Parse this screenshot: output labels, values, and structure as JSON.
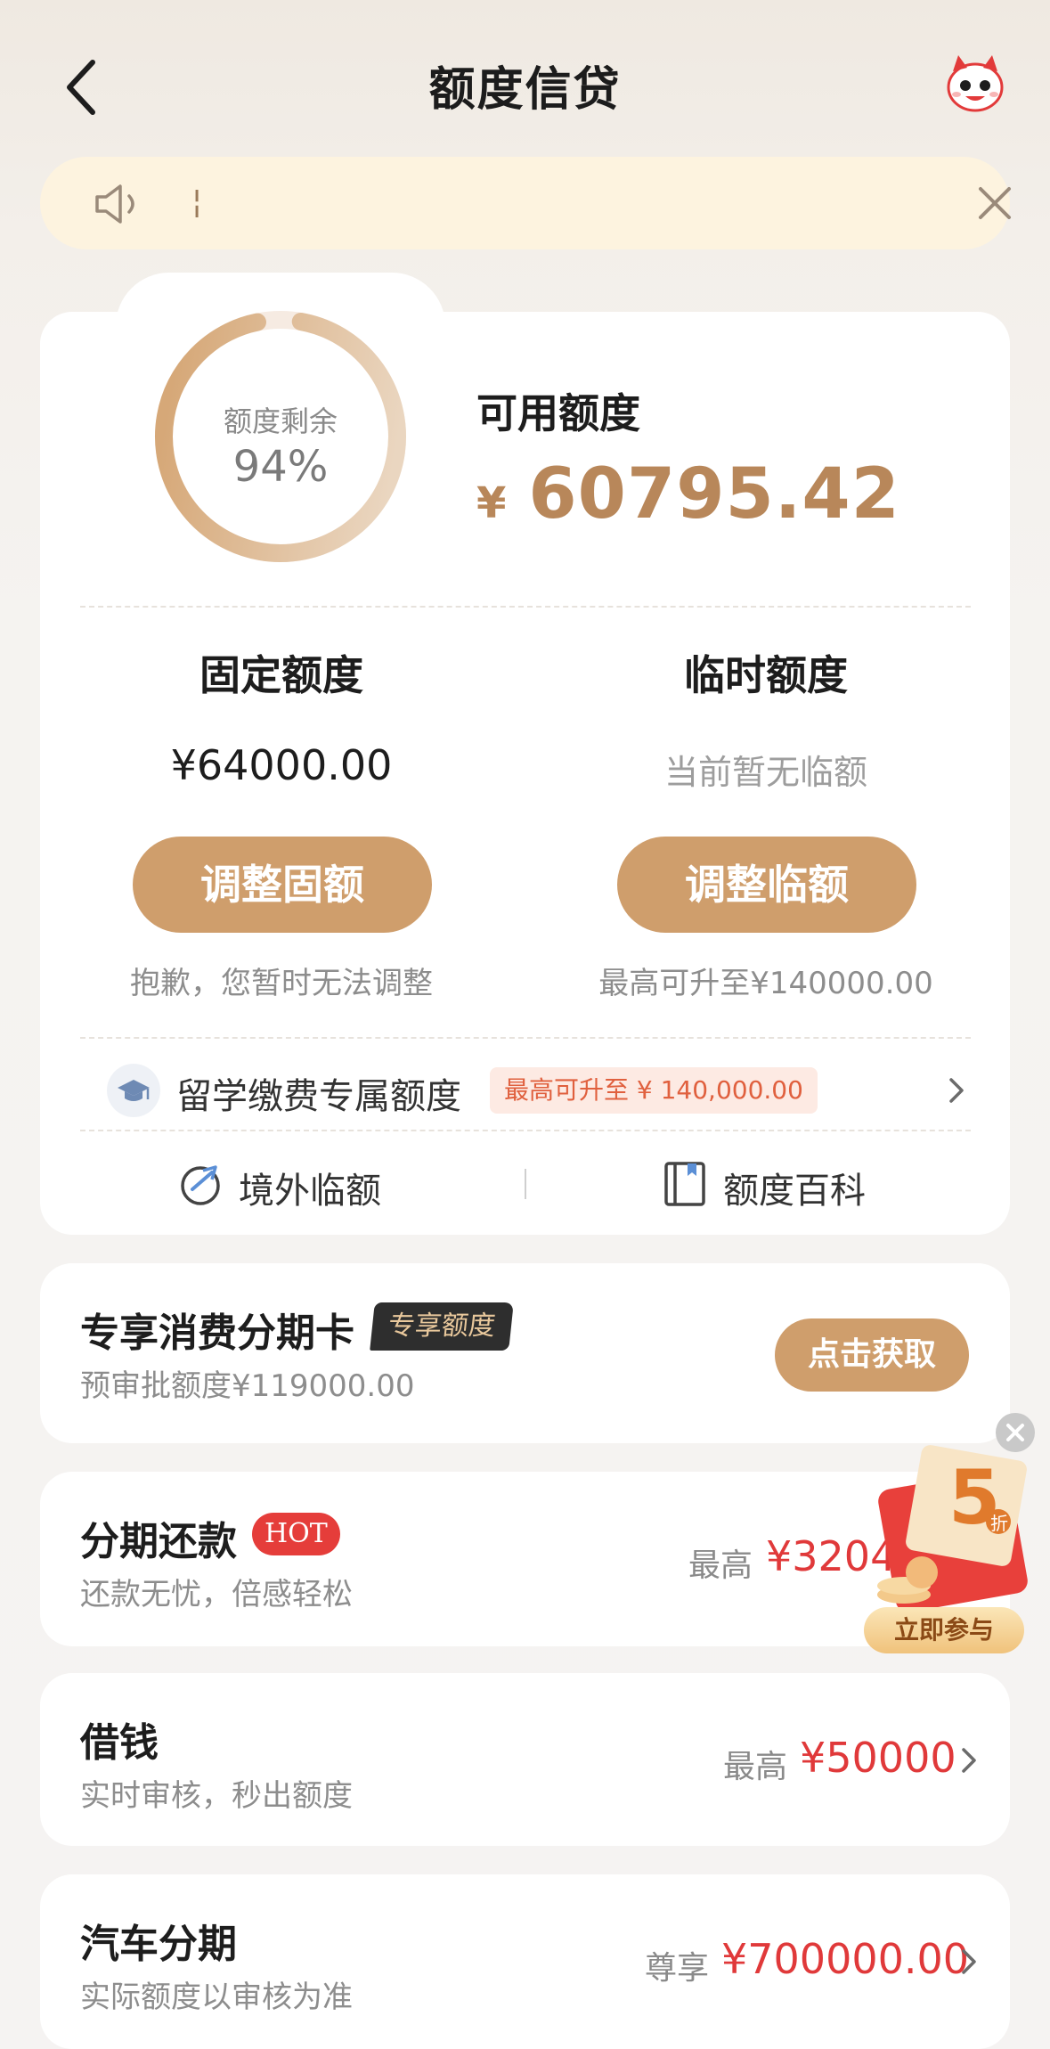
{
  "header": {
    "title": "额度信贷"
  },
  "notice": {
    "text": "¦"
  },
  "summary": {
    "ring_label": "额度剩余",
    "ring_value": "94%",
    "remaining_fraction": 0.94,
    "available_title": "可用额度",
    "currency": "¥",
    "available_amount": "60795.42"
  },
  "fixed": {
    "title": "固定额度",
    "amount": "¥64000.00",
    "button": "调整固额",
    "note": "抱歉，您暂时无法调整"
  },
  "temporary": {
    "title": "临时额度",
    "status": "当前暂无临额",
    "button": "调整临额",
    "note": "最高可升至¥140000.00"
  },
  "study": {
    "label": "留学缴费专属额度",
    "badge": "最高可升至 ¥ 140,000.00"
  },
  "links": {
    "overseas": "境外临额",
    "encyclopedia": "额度百科"
  },
  "exclusive": {
    "title": "专享消费分期卡",
    "tag": "专享额度",
    "sub": "预审批额度¥119000.00",
    "button": "点击获取"
  },
  "installment": {
    "title": "分期还款",
    "tag": "HOT",
    "sub": "还款无忧，倍感轻松",
    "prefix": "最高",
    "amount": "¥3204."
  },
  "borrow": {
    "title": "借钱",
    "sub": "实时审核，秒出额度",
    "prefix": "最高",
    "amount": "¥50000"
  },
  "car": {
    "title": "汽车分期",
    "sub": "实际额度以审核为准",
    "prefix": "尊享",
    "amount": "¥700000.00"
  },
  "promo": {
    "number": "5",
    "unit": "折",
    "button": "立即参与"
  },
  "colors": {
    "accent": "#cf9e6c",
    "amount_gold": "#b8875a",
    "amount_red": "#e0393a"
  }
}
